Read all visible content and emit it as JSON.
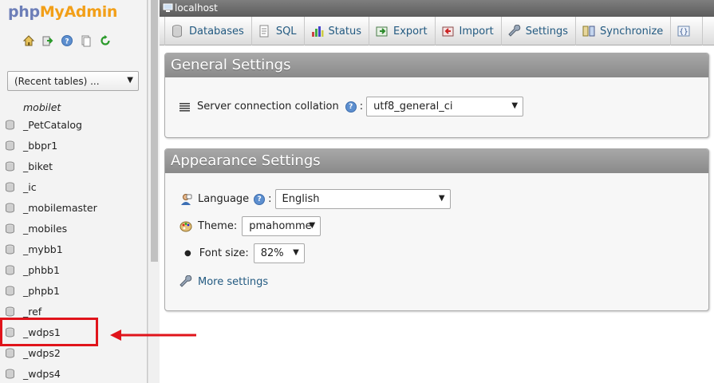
{
  "logo": {
    "part1": "php",
    "part2": "MyAdmin"
  },
  "nav": {
    "quick_icons": [
      "home-icon",
      "exit-icon",
      "help-icon",
      "docs-icon",
      "reload-icon"
    ],
    "recent_tables": "(Recent tables) ...",
    "db_header": "mobilet",
    "databases": [
      "_PetCatalog",
      "_bbpr1",
      "_biket",
      "_ic",
      "_mobilemaster",
      "_mobiles",
      "_mybb1",
      "_phbb1",
      "_phpb1",
      "_ref",
      "_wdps1",
      "_wdps2",
      "_wdps4"
    ]
  },
  "server_bar": {
    "label": "localhost"
  },
  "tabs": [
    {
      "label": "Databases",
      "icon": "database-icon"
    },
    {
      "label": "SQL",
      "icon": "sql-icon"
    },
    {
      "label": "Status",
      "icon": "status-icon"
    },
    {
      "label": "Export",
      "icon": "export-icon"
    },
    {
      "label": "Import",
      "icon": "import-icon"
    },
    {
      "label": "Settings",
      "icon": "wrench-icon"
    },
    {
      "label": "Synchronize",
      "icon": "sync-icon"
    }
  ],
  "general": {
    "title": "General Settings",
    "collation_label": "Server connection collation",
    "collation_value": "utf8_general_ci"
  },
  "appearance": {
    "title": "Appearance Settings",
    "language_label": "Language",
    "language_value": "English",
    "theme_label": "Theme:",
    "theme_value": "pmahomme",
    "font_label": "Font size:",
    "font_value": "82%",
    "more_settings": "More settings"
  },
  "colors": {
    "accent_red": "#e0141b",
    "link": "#235a81",
    "logo_orange": "#f29f18",
    "logo_blue": "#6c7eb8"
  }
}
